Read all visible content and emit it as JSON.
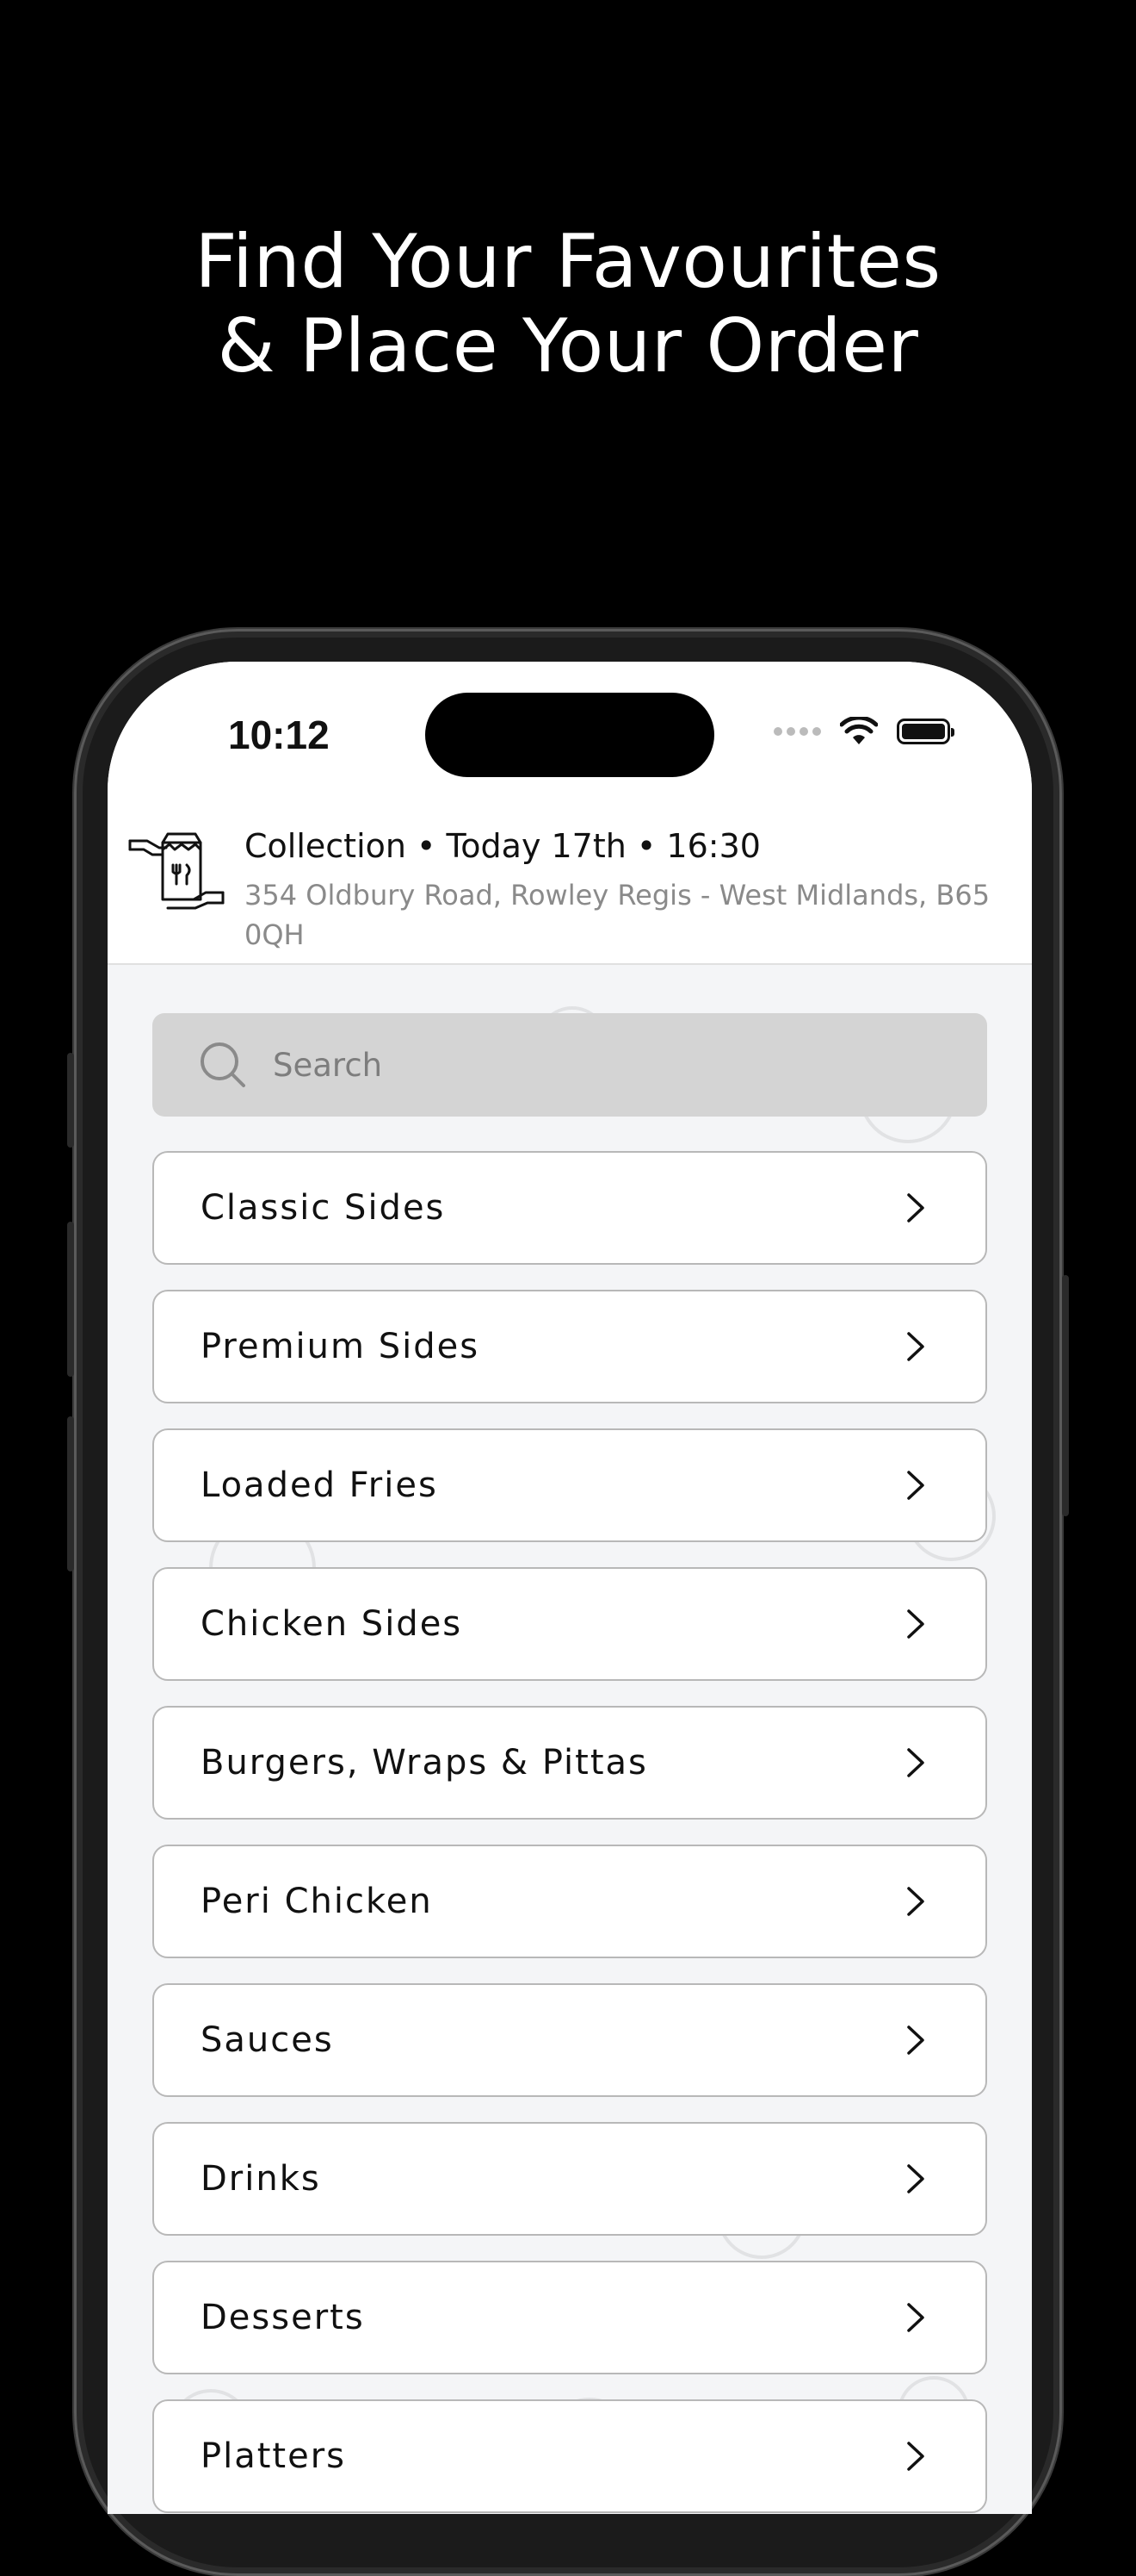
{
  "promo": {
    "line1": "Find Your Favourites",
    "line2": "& Place Your Order"
  },
  "status_bar": {
    "time": "10:12"
  },
  "header": {
    "title": "Collection • Today 17th • 16:30",
    "address": "354 Oldbury Road, Rowley Regis - West Midlands, B65 0QH"
  },
  "search": {
    "placeholder": "Search"
  },
  "categories": [
    {
      "label": "Classic Sides"
    },
    {
      "label": "Premium Sides"
    },
    {
      "label": "Loaded Fries"
    },
    {
      "label": "Chicken Sides"
    },
    {
      "label": "Burgers, Wraps & Pittas"
    },
    {
      "label": "Peri Chicken"
    },
    {
      "label": "Sauces"
    },
    {
      "label": "Drinks"
    },
    {
      "label": "Desserts"
    },
    {
      "label": "Platters"
    }
  ]
}
